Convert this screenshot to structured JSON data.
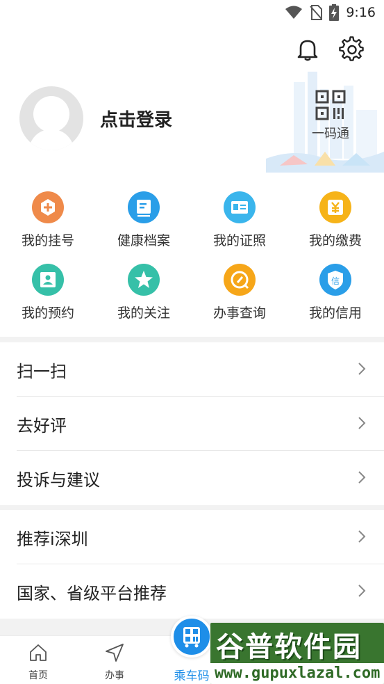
{
  "status_bar": {
    "time": "9:16"
  },
  "profile": {
    "login_text": "点击登录",
    "qr_label": "一码通"
  },
  "colors": {
    "accent": "#1e8ee8",
    "orange": "#ef8a4a",
    "blue": "#2a9ee8",
    "yellow": "#f6b319",
    "teal": "#36c0a8"
  },
  "grid": [
    {
      "label": "我的挂号",
      "icon": "plus-badge-icon",
      "color": "#ef8a4a"
    },
    {
      "label": "健康档案",
      "icon": "document-icon",
      "color": "#2a9ee8"
    },
    {
      "label": "我的证照",
      "icon": "id-card-icon",
      "color": "#3ab5ec"
    },
    {
      "label": "我的缴费",
      "icon": "yen-icon",
      "color": "#f6b319"
    },
    {
      "label": "我的预约",
      "icon": "person-card-icon",
      "color": "#36c0a8"
    },
    {
      "label": "我的关注",
      "icon": "star-icon",
      "color": "#36c0a8"
    },
    {
      "label": "办事查询",
      "icon": "search-icon",
      "color": "#f6a619"
    },
    {
      "label": "我的信用",
      "icon": "credit-shield-icon",
      "color": "#2a9ee8"
    }
  ],
  "menu_group_1": [
    {
      "label": "扫一扫"
    },
    {
      "label": "去好评"
    },
    {
      "label": "投诉与建议"
    }
  ],
  "menu_group_2": [
    {
      "label": "推荐i深圳"
    },
    {
      "label": "国家、省级平台推荐"
    }
  ],
  "tabbar": {
    "home": "首页",
    "affairs": "办事",
    "ride_code": "乘车码"
  },
  "watermark": {
    "title": "谷普软件园",
    "url": "www.gupuxlazal.com"
  }
}
